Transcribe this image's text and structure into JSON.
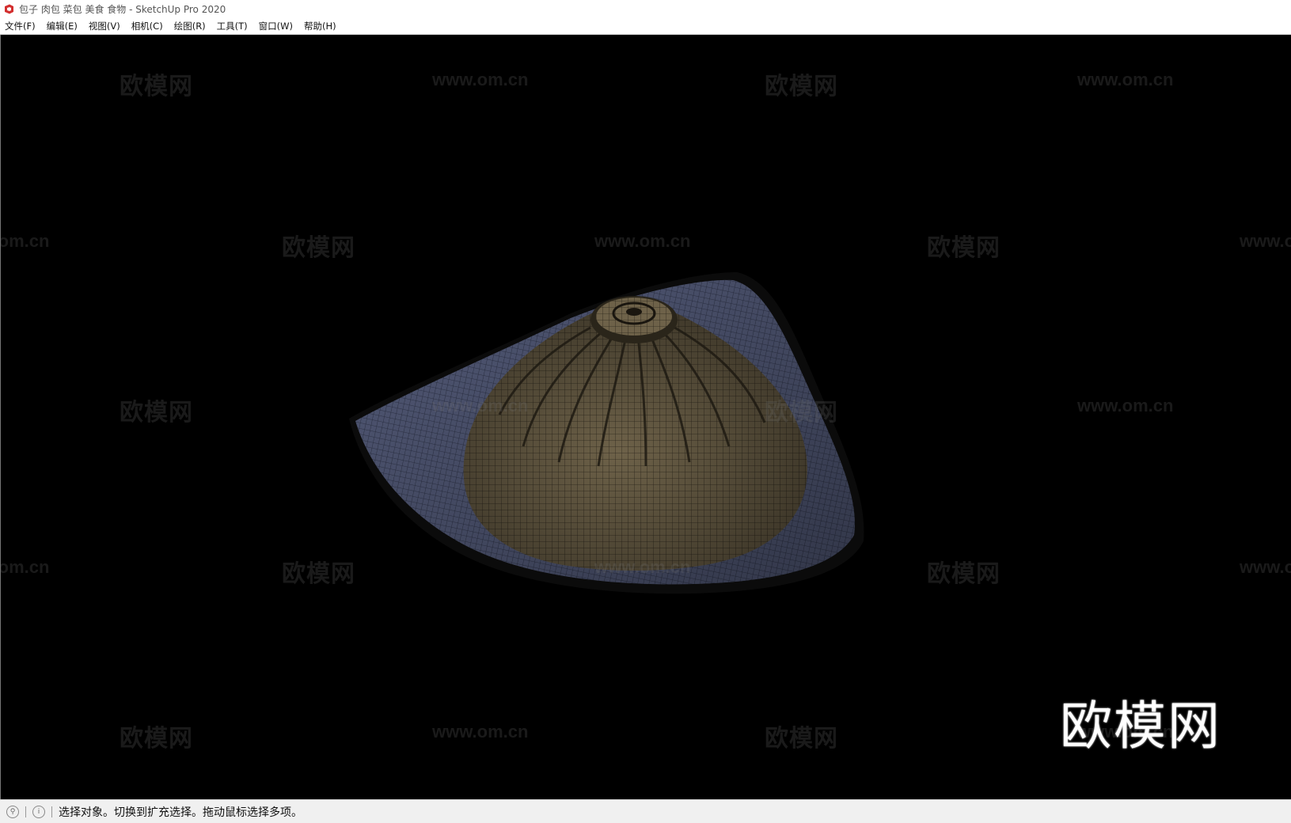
{
  "window": {
    "title": "包子 肉包 菜包 美食 食物 - SketchUp Pro 2020",
    "icon": "sketchup-icon",
    "icon_color": "#d32f2f"
  },
  "menubar": {
    "items": [
      {
        "label": "文件(F)"
      },
      {
        "label": "编辑(E)"
      },
      {
        "label": "视图(V)"
      },
      {
        "label": "相机(C)"
      },
      {
        "label": "绘图(R)"
      },
      {
        "label": "工具(T)"
      },
      {
        "label": "窗口(W)"
      },
      {
        "label": "帮助(H)"
      }
    ]
  },
  "viewport": {
    "background": "#000000",
    "model_description_colors": {
      "bun": "#6b5e45",
      "plate": "#59607a",
      "mesh": "#1a1a1a"
    },
    "watermark_cn": "欧模网",
    "watermark_url": "www.om.cn",
    "logo": "欧模网"
  },
  "statusbar": {
    "icons": [
      "geo-location-icon",
      "info-icon"
    ],
    "message": "选择对象。切换到扩充选择。拖动鼠标选择多项。"
  }
}
